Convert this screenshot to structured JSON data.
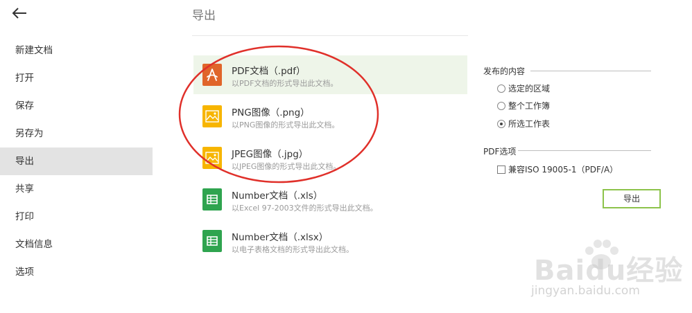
{
  "sidebar": {
    "back_icon": "arrow-left-icon",
    "items": [
      {
        "label": "新建文档"
      },
      {
        "label": "打开"
      },
      {
        "label": "保存"
      },
      {
        "label": "另存为"
      },
      {
        "label": "导出",
        "active": true
      },
      {
        "label": "共享"
      },
      {
        "label": "打印"
      },
      {
        "label": "文档信息"
      },
      {
        "label": "选项"
      }
    ]
  },
  "main": {
    "title": "导出",
    "formats": [
      {
        "name": "PDF文档（.pdf）",
        "desc": "以PDF文档的形式导出此文档。",
        "icon": "pdf-icon",
        "selected": true
      },
      {
        "name": "PNG图像（.png）",
        "desc": "以PNG图像的形式导出此文档。",
        "icon": "image-icon"
      },
      {
        "name": "JPEG图像（.jpg）",
        "desc": "以JPEG图像的形式导出此文档。",
        "icon": "image-icon"
      },
      {
        "name": "Number文档（.xls）",
        "desc": "以Excel 97-2003文件的形式导出此文档。",
        "icon": "spreadsheet-icon"
      },
      {
        "name": "Number文档（.xlsx）",
        "desc": "以电子表格文档的形式导出此文档。",
        "icon": "spreadsheet-icon"
      }
    ]
  },
  "options": {
    "publish_heading": "发布的内容",
    "publish_options": [
      {
        "label": "选定的区域",
        "checked": false
      },
      {
        "label": "整个工作簿",
        "checked": false
      },
      {
        "label": "所选工作表",
        "checked": true
      }
    ],
    "pdf_heading": "PDF选项",
    "pdf_compat_label": "兼容ISO 19005-1（PDF/A）",
    "pdf_compat_checked": false,
    "export_button": "导出"
  },
  "watermark": {
    "brand": "Baidu经验",
    "url": "jingyan.baidu.com"
  },
  "colors": {
    "pdf_icon": "#e0652a",
    "image_icon": "#f7b500",
    "sheet_icon": "#2fa44f",
    "selected_bg": "#eef5e9",
    "active_menu_bg": "#e3e3e3",
    "button_border": "#8cc34a",
    "annotation": "#e0302a"
  }
}
